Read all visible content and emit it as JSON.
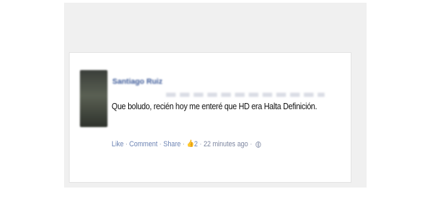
{
  "post": {
    "author": "Santiago Ruiz",
    "message": "Que boludo, recién hoy me enteré que HD era Halta Definición.",
    "actions": {
      "like": "Like",
      "comment": "Comment",
      "share": "Share",
      "separator": "·",
      "like_count": "2",
      "timestamp": "22 minutes ago"
    }
  },
  "icons": {
    "like": "thumbs-up-icon",
    "privacy": "globe-icon"
  },
  "colors": {
    "link": "#6d84b4",
    "author": "#3b5998",
    "text": "#111111"
  }
}
